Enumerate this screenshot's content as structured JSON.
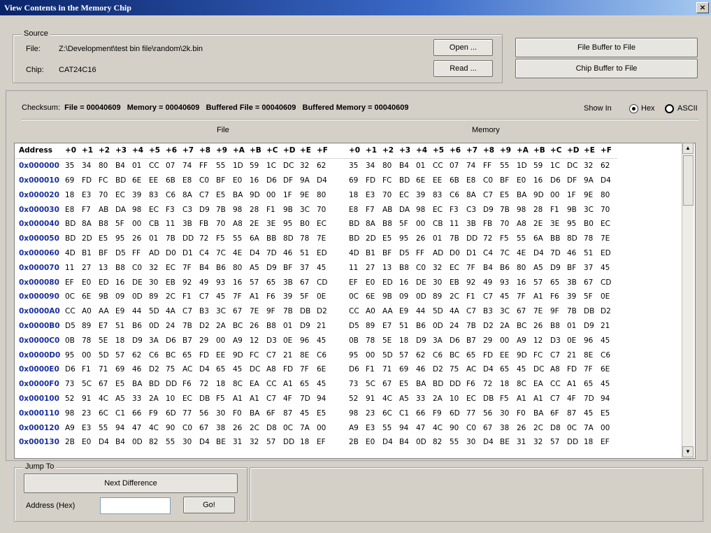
{
  "window": {
    "title": "View Contents in the Memory Chip",
    "close": "×"
  },
  "source": {
    "legend": "Source",
    "file_label": "File:",
    "file_value": "Z:\\Development\\test bin file\\random\\2k.bin",
    "chip_label": "Chip:",
    "chip_value": "CAT24C16",
    "open_button": "Open ...",
    "read_button": "Read ..."
  },
  "actions": {
    "file_buffer_button": "File Buffer to File",
    "chip_buffer_button": "Chip Buffer to File"
  },
  "checksum": {
    "label": "Checksum:",
    "file": "File = 00040609",
    "memory": "Memory = 00040609",
    "buffered_file": "Buffered File = 00040609",
    "buffered_memory": "Buffered Memory = 00040609"
  },
  "show_in": {
    "label": "Show In",
    "hex": "Hex",
    "ascii": "ASCII",
    "selected": "Hex"
  },
  "grid": {
    "file_header": "File",
    "memory_header": "Memory",
    "address_header": "Address",
    "columns": [
      "+0",
      "+1",
      "+2",
      "+3",
      "+4",
      "+5",
      "+6",
      "+7",
      "+8",
      "+9",
      "+A",
      "+B",
      "+C",
      "+D",
      "+E",
      "+F"
    ],
    "rows": [
      {
        "addr": "0x000000",
        "b": [
          "35",
          "34",
          "80",
          "B4",
          "01",
          "CC",
          "07",
          "74",
          "FF",
          "55",
          "1D",
          "59",
          "1C",
          "DC",
          "32",
          "62"
        ]
      },
      {
        "addr": "0x000010",
        "b": [
          "69",
          "FD",
          "FC",
          "BD",
          "6E",
          "EE",
          "6B",
          "E8",
          "C0",
          "BF",
          "E0",
          "16",
          "D6",
          "DF",
          "9A",
          "D4"
        ]
      },
      {
        "addr": "0x000020",
        "b": [
          "18",
          "E3",
          "70",
          "EC",
          "39",
          "83",
          "C6",
          "8A",
          "C7",
          "E5",
          "BA",
          "9D",
          "00",
          "1F",
          "9E",
          "80"
        ]
      },
      {
        "addr": "0x000030",
        "b": [
          "E8",
          "F7",
          "AB",
          "DA",
          "98",
          "EC",
          "F3",
          "C3",
          "D9",
          "7B",
          "98",
          "28",
          "F1",
          "9B",
          "3C",
          "70"
        ]
      },
      {
        "addr": "0x000040",
        "b": [
          "BD",
          "8A",
          "B8",
          "5F",
          "00",
          "CB",
          "11",
          "3B",
          "FB",
          "70",
          "A8",
          "2E",
          "3E",
          "95",
          "B0",
          "EC"
        ]
      },
      {
        "addr": "0x000050",
        "b": [
          "BD",
          "2D",
          "E5",
          "95",
          "26",
          "01",
          "7B",
          "DD",
          "72",
          "F5",
          "55",
          "6A",
          "BB",
          "8D",
          "78",
          "7E"
        ]
      },
      {
        "addr": "0x000060",
        "b": [
          "4D",
          "B1",
          "BF",
          "D5",
          "FF",
          "AD",
          "D0",
          "D1",
          "C4",
          "7C",
          "4E",
          "D4",
          "7D",
          "46",
          "51",
          "ED"
        ]
      },
      {
        "addr": "0x000070",
        "b": [
          "11",
          "27",
          "13",
          "B8",
          "C0",
          "32",
          "EC",
          "7F",
          "B4",
          "B6",
          "80",
          "A5",
          "D9",
          "BF",
          "37",
          "45"
        ]
      },
      {
        "addr": "0x000080",
        "b": [
          "EF",
          "E0",
          "ED",
          "16",
          "DE",
          "30",
          "EB",
          "92",
          "49",
          "93",
          "16",
          "57",
          "65",
          "3B",
          "67",
          "CD"
        ]
      },
      {
        "addr": "0x000090",
        "b": [
          "0C",
          "6E",
          "9B",
          "09",
          "0D",
          "89",
          "2C",
          "F1",
          "C7",
          "45",
          "7F",
          "A1",
          "F6",
          "39",
          "5F",
          "0E"
        ]
      },
      {
        "addr": "0x0000A0",
        "b": [
          "CC",
          "A0",
          "AA",
          "E9",
          "44",
          "5D",
          "4A",
          "C7",
          "B3",
          "3C",
          "67",
          "7E",
          "9F",
          "7B",
          "DB",
          "D2"
        ]
      },
      {
        "addr": "0x0000B0",
        "b": [
          "D5",
          "89",
          "E7",
          "51",
          "B6",
          "0D",
          "24",
          "7B",
          "D2",
          "2A",
          "BC",
          "26",
          "B8",
          "01",
          "D9",
          "21"
        ]
      },
      {
        "addr": "0x0000C0",
        "b": [
          "0B",
          "78",
          "5E",
          "18",
          "D9",
          "3A",
          "D6",
          "B7",
          "29",
          "00",
          "A9",
          "12",
          "D3",
          "0E",
          "96",
          "45"
        ]
      },
      {
        "addr": "0x0000D0",
        "b": [
          "95",
          "00",
          "5D",
          "57",
          "62",
          "C6",
          "BC",
          "65",
          "FD",
          "EE",
          "9D",
          "FC",
          "C7",
          "21",
          "8E",
          "C6"
        ]
      },
      {
        "addr": "0x0000E0",
        "b": [
          "D6",
          "F1",
          "71",
          "69",
          "46",
          "D2",
          "75",
          "AC",
          "D4",
          "65",
          "45",
          "DC",
          "A8",
          "FD",
          "7F",
          "6E"
        ]
      },
      {
        "addr": "0x0000F0",
        "b": [
          "73",
          "5C",
          "67",
          "E5",
          "BA",
          "BD",
          "DD",
          "F6",
          "72",
          "18",
          "8C",
          "EA",
          "CC",
          "A1",
          "65",
          "45"
        ]
      },
      {
        "addr": "0x000100",
        "b": [
          "52",
          "91",
          "4C",
          "A5",
          "33",
          "2A",
          "10",
          "EC",
          "DB",
          "F5",
          "A1",
          "A1",
          "C7",
          "4F",
          "7D",
          "94"
        ]
      },
      {
        "addr": "0x000110",
        "b": [
          "98",
          "23",
          "6C",
          "C1",
          "66",
          "F9",
          "6D",
          "77",
          "56",
          "30",
          "F0",
          "BA",
          "6F",
          "87",
          "45",
          "E5"
        ]
      },
      {
        "addr": "0x000120",
        "b": [
          "A9",
          "E3",
          "55",
          "94",
          "47",
          "4C",
          "90",
          "C0",
          "67",
          "38",
          "26",
          "2C",
          "D8",
          "0C",
          "7A",
          "00"
        ]
      },
      {
        "addr": "0x000130",
        "b": [
          "2B",
          "E0",
          "D4",
          "B4",
          "0D",
          "82",
          "55",
          "30",
          "D4",
          "BE",
          "31",
          "32",
          "57",
          "DD",
          "18",
          "EF"
        ]
      }
    ]
  },
  "jump_to": {
    "legend": "Jump To",
    "next_difference": "Next Difference",
    "address_label": "Address (Hex)",
    "address_value": "",
    "go_button": "Go!"
  },
  "colors": {
    "address_text": "#1a2fa0",
    "title_bar_start": "#0a246a"
  },
  "icons": {
    "scroll_up": "scroll-up-arrow-icon",
    "scroll_down": "scroll-down-arrow-icon"
  }
}
